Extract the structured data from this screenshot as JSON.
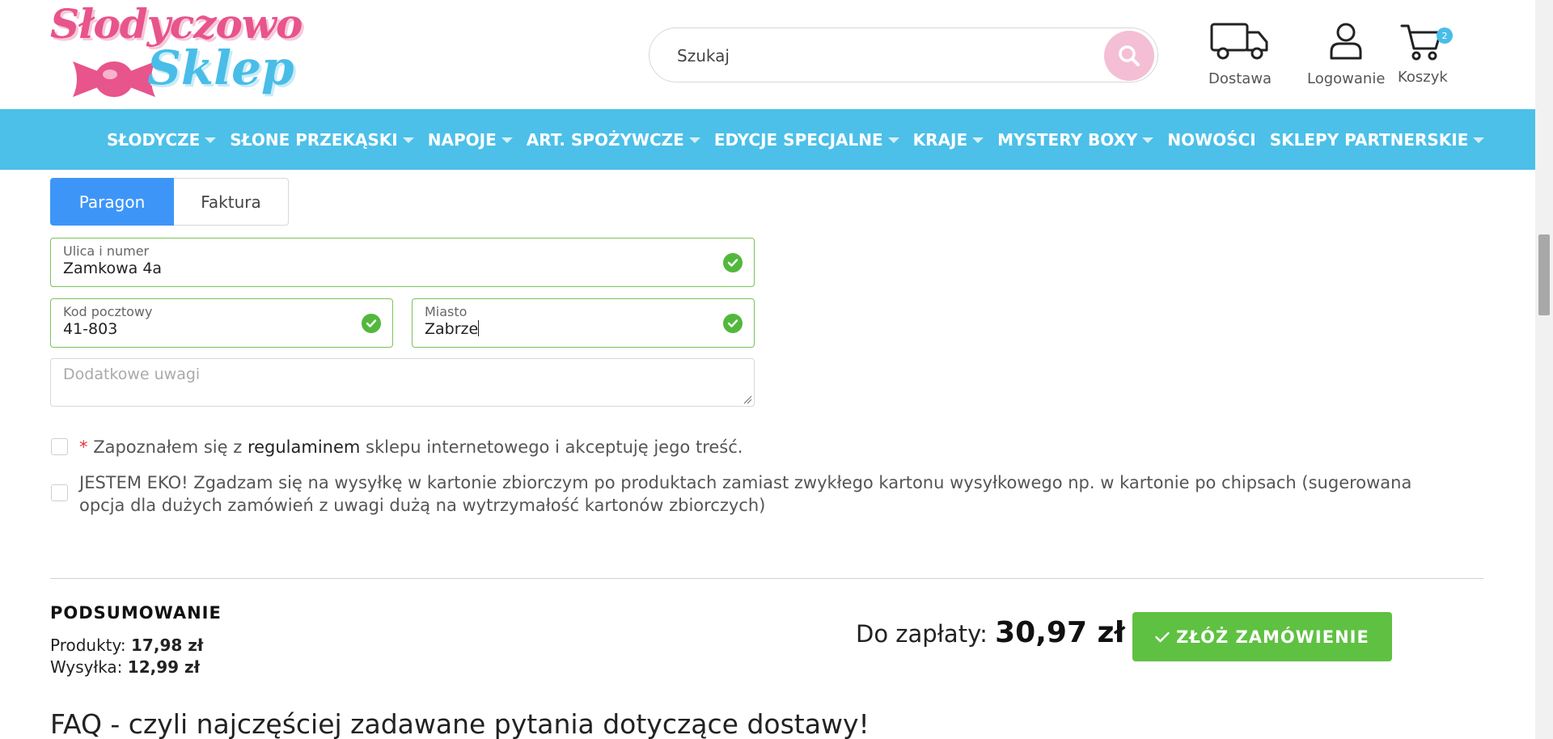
{
  "header": {
    "logo": {
      "line1": "Słodyczowo",
      "line2": "Sklep"
    },
    "search": {
      "placeholder": "Szukaj"
    },
    "icons": [
      {
        "name": "truck-icon",
        "label": "Dostawa"
      },
      {
        "name": "user-icon",
        "label": "Logowanie"
      },
      {
        "name": "cart-icon",
        "label": "Koszyk",
        "badge": "2"
      }
    ]
  },
  "nav": {
    "items": [
      {
        "label": "SŁODYCZE"
      },
      {
        "label": "SŁONE PRZEKĄSKI"
      },
      {
        "label": "NAPOJE"
      },
      {
        "label": "ART. SPOŻYWCZE"
      },
      {
        "label": "EDYCJE SPECJALNE"
      },
      {
        "label": "KRAJE"
      },
      {
        "label": "MYSTERY BOXY"
      },
      {
        "label": "NOWOŚCI"
      },
      {
        "label": "SKLEPY PARTNERSKIE"
      }
    ]
  },
  "form": {
    "tabs": {
      "receipt": "Paragon",
      "invoice": "Faktura"
    },
    "street": {
      "label": "Ulica i numer",
      "value": "Zamkowa 4a"
    },
    "postal": {
      "label": "Kod pocztowy",
      "value": "41-803"
    },
    "city": {
      "label": "Miasto",
      "value": "Zabrze"
    },
    "notes": {
      "placeholder": "Dodatkowe uwagi"
    },
    "terms": {
      "required_mark": "*",
      "before": "Zapoznałem się z",
      "link": "regulaminem",
      "after": "sklepu internetowego i akceptuję jego treść."
    },
    "eco": {
      "line1": "JESTEM EKO! Zgadzam się na wysyłkę w kartonie zbiorczym po produktach zamiast zwykłego kartonu wysyłkowego np. w kartonie po chipsach (sugerowana",
      "line2": "opcja dla dużych zamówień z uwagi dużą na wytrzymałość kartonów zbiorczych)"
    }
  },
  "summary": {
    "title": "PODSUMOWANIE",
    "products_label": "Produkty:",
    "products_value": "17,98 zł",
    "shipping_label": "Wysyłka:",
    "shipping_value": "12,99 zł",
    "to_pay_label": "Do zapłaty:",
    "to_pay_value": "30,97 zł",
    "order_button": "ZŁÓŻ ZAMÓWIENIE"
  },
  "faq": {
    "title": "FAQ - czyli najczęściej zadawane pytania dotyczące dostawy!"
  },
  "colors": {
    "nav_bg": "#4cc0e8",
    "tab_active": "#3e95f8",
    "valid_border": "#7cc258",
    "order_button": "#5fc142",
    "logo_pink": "#e8548c",
    "logo_blue": "#49bde8"
  }
}
